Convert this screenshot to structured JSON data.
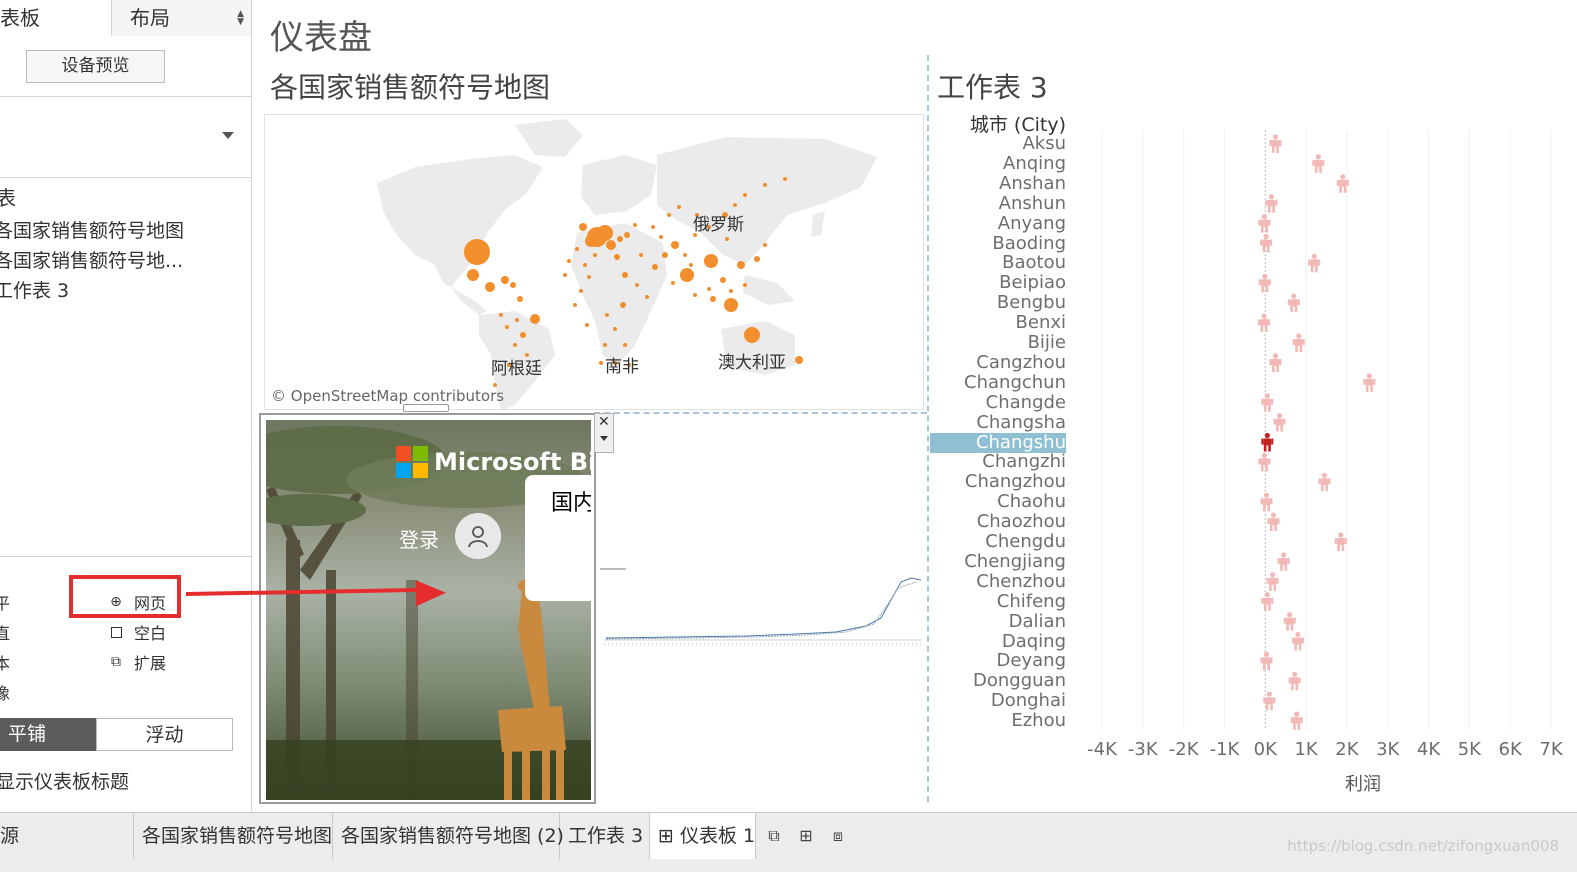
{
  "left_panel": {
    "tab_dashboard": "表板",
    "tab_layout": "布局",
    "device_preview": "设备预览",
    "sheets_heading": "表",
    "sheets": [
      "各国家销售额符号地图",
      "各国家销售额符号地...",
      "工作表 3"
    ],
    "object_labels": [
      "平",
      "直",
      "本",
      "像"
    ],
    "objects": {
      "webpage": "网页",
      "blank": "空白",
      "extension": "扩展"
    },
    "tiled": "平铺",
    "floating": "浮动",
    "show_title": "显示仪表板标题"
  },
  "dashboard": {
    "title": "仪表盘",
    "map_title": "各国家销售额符号地图",
    "sheet3_title": "工作表 3",
    "map_labels": {
      "russia": "俄罗斯",
      "argentina": "阿根廷",
      "south_africa": "南非",
      "australia": "澳大利亚"
    },
    "osm_credit": "© OpenStreetMap contributors",
    "bing": {
      "logo_text": "Microsoft Bing",
      "login": "登录",
      "card_text": "国内"
    }
  },
  "worksheet3": {
    "header": "城市 (City)",
    "highlighted": "Changshu",
    "axis_title": "利润",
    "axis_ticks": [
      "-4K",
      "-3K",
      "-2K",
      "-1K",
      "0K",
      "1K",
      "2K",
      "3K",
      "4K",
      "5K",
      "6K",
      "7K"
    ],
    "cities": [
      {
        "name": "Aksu",
        "profit": 250
      },
      {
        "name": "Anqing",
        "profit": 1300
      },
      {
        "name": "Anshan",
        "profit": 1900
      },
      {
        "name": "Anshun",
        "profit": 150
      },
      {
        "name": "Anyang",
        "profit": -20
      },
      {
        "name": "Baoding",
        "profit": 20
      },
      {
        "name": "Baotou",
        "profit": 1200
      },
      {
        "name": "Beipiao",
        "profit": -10
      },
      {
        "name": "Bengbu",
        "profit": 700
      },
      {
        "name": "Benxi",
        "profit": -30
      },
      {
        "name": "Bijie",
        "profit": 820
      },
      {
        "name": "Cangzhou",
        "profit": 250
      },
      {
        "name": "Changchun",
        "profit": 2550
      },
      {
        "name": "Changde",
        "profit": 50
      },
      {
        "name": "Changsha",
        "profit": 350
      },
      {
        "name": "Changshu",
        "profit": 50
      },
      {
        "name": "Changzhi",
        "profit": -20
      },
      {
        "name": "Changzhou",
        "profit": 1450
      },
      {
        "name": "Chaohu",
        "profit": 30
      },
      {
        "name": "Chaozhou",
        "profit": 200
      },
      {
        "name": "Chengdu",
        "profit": 1850
      },
      {
        "name": "Chengjiang",
        "profit": 450
      },
      {
        "name": "Chenzhou",
        "profit": 180
      },
      {
        "name": "Chifeng",
        "profit": 50
      },
      {
        "name": "Dalian",
        "profit": 600
      },
      {
        "name": "Daqing",
        "profit": 800
      },
      {
        "name": "Deyang",
        "profit": 30
      },
      {
        "name": "Dongguan",
        "profit": 720
      },
      {
        "name": "Donghai",
        "profit": 100
      },
      {
        "name": "Ezhou",
        "profit": 770
      }
    ]
  },
  "bottom_tabs": {
    "datasource": "源",
    "tabs": [
      "各国家销售额符号地图",
      "各国家销售额符号地图 (2)",
      "工作表 3",
      "仪表板 1"
    ],
    "watermark": "https://blog.csdn.net/zifongxuan008"
  },
  "colors": {
    "map_dot": "#f28e2b",
    "person": "#f2b8b5",
    "person_selected": "#c31f1f",
    "highlight": "#8ebfd3",
    "red_annotation": "#e62d2d"
  }
}
